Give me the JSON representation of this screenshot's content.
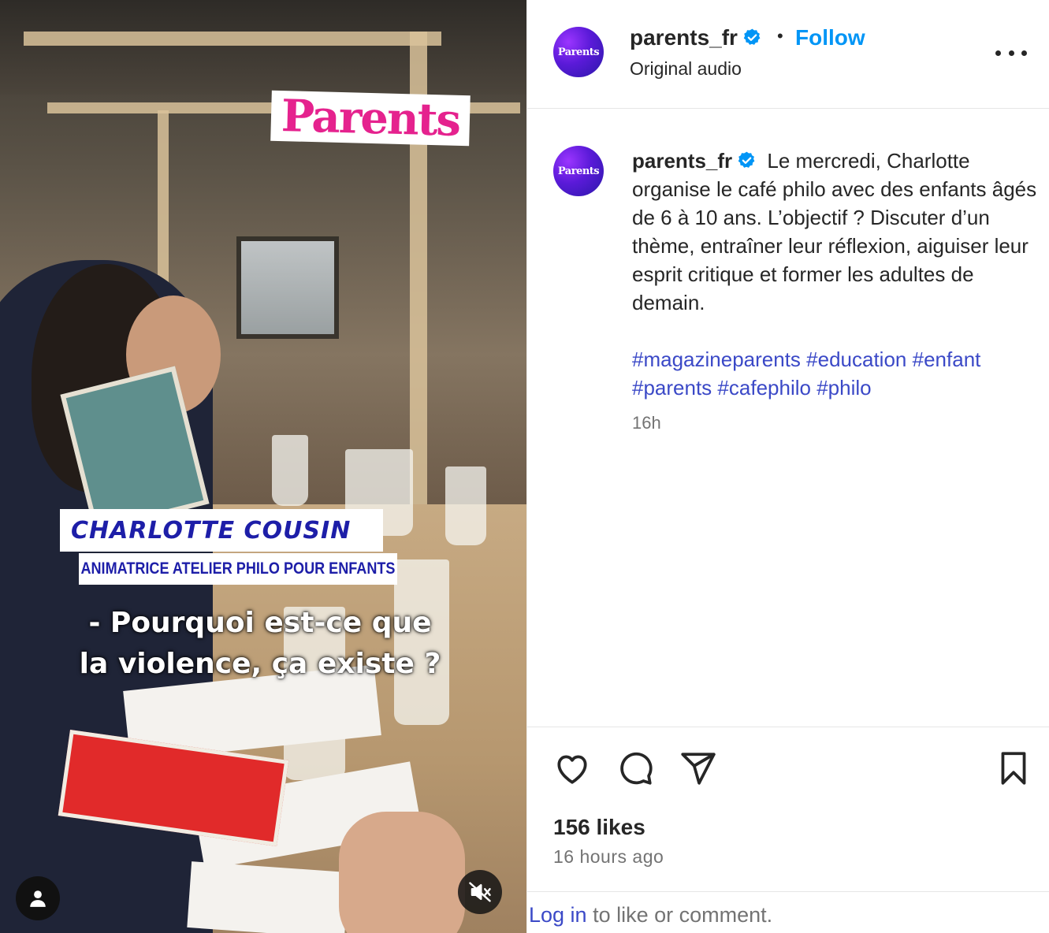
{
  "video": {
    "logo_text": "Parents",
    "name_card": "CHARLOTTE COUSIN",
    "role_card": "ANIMATRICE ATELIER PHILO POUR ENFANTS",
    "subtitle_line1": "- Pourquoi est-ce que",
    "subtitle_line2": "la violence, ça existe ?"
  },
  "header": {
    "avatar_text": "Parents",
    "username": "parents_fr",
    "separator": "•",
    "follow_label": "Follow",
    "audio": "Original audio"
  },
  "caption": {
    "avatar_text": "Parents",
    "username": "parents_fr",
    "text": "Le mercredi, Charlotte organise le café philo avec des enfants âgés de 6 à 10 ans. L’objectif ? Discuter d’un thème, entraîner leur réflexion, aiguiser leur esprit critique et former les adultes de demain.",
    "hashtags": [
      "#magazineparents",
      "#education",
      "#enfant",
      "#parents",
      "#cafephilo",
      "#philo"
    ],
    "time": "16h"
  },
  "stats": {
    "likes": "156 likes",
    "time_ago": "16 hours ago"
  },
  "footer": {
    "login_label": "Log in",
    "rest": " to like or comment."
  },
  "icons": {
    "verified": "verified-badge-icon",
    "more": "more-options-icon",
    "like": "heart-icon",
    "comment": "comment-icon",
    "share": "share-icon",
    "save": "bookmark-icon",
    "user": "user-icon",
    "mute": "muted-speaker-icon"
  },
  "colors": {
    "accent_blue": "#0095f6",
    "link_blue": "#3b49c7",
    "brand_pink": "#e5228e",
    "caption_card_blue": "#1d1ea8",
    "verified_blue": "#0095f6"
  }
}
